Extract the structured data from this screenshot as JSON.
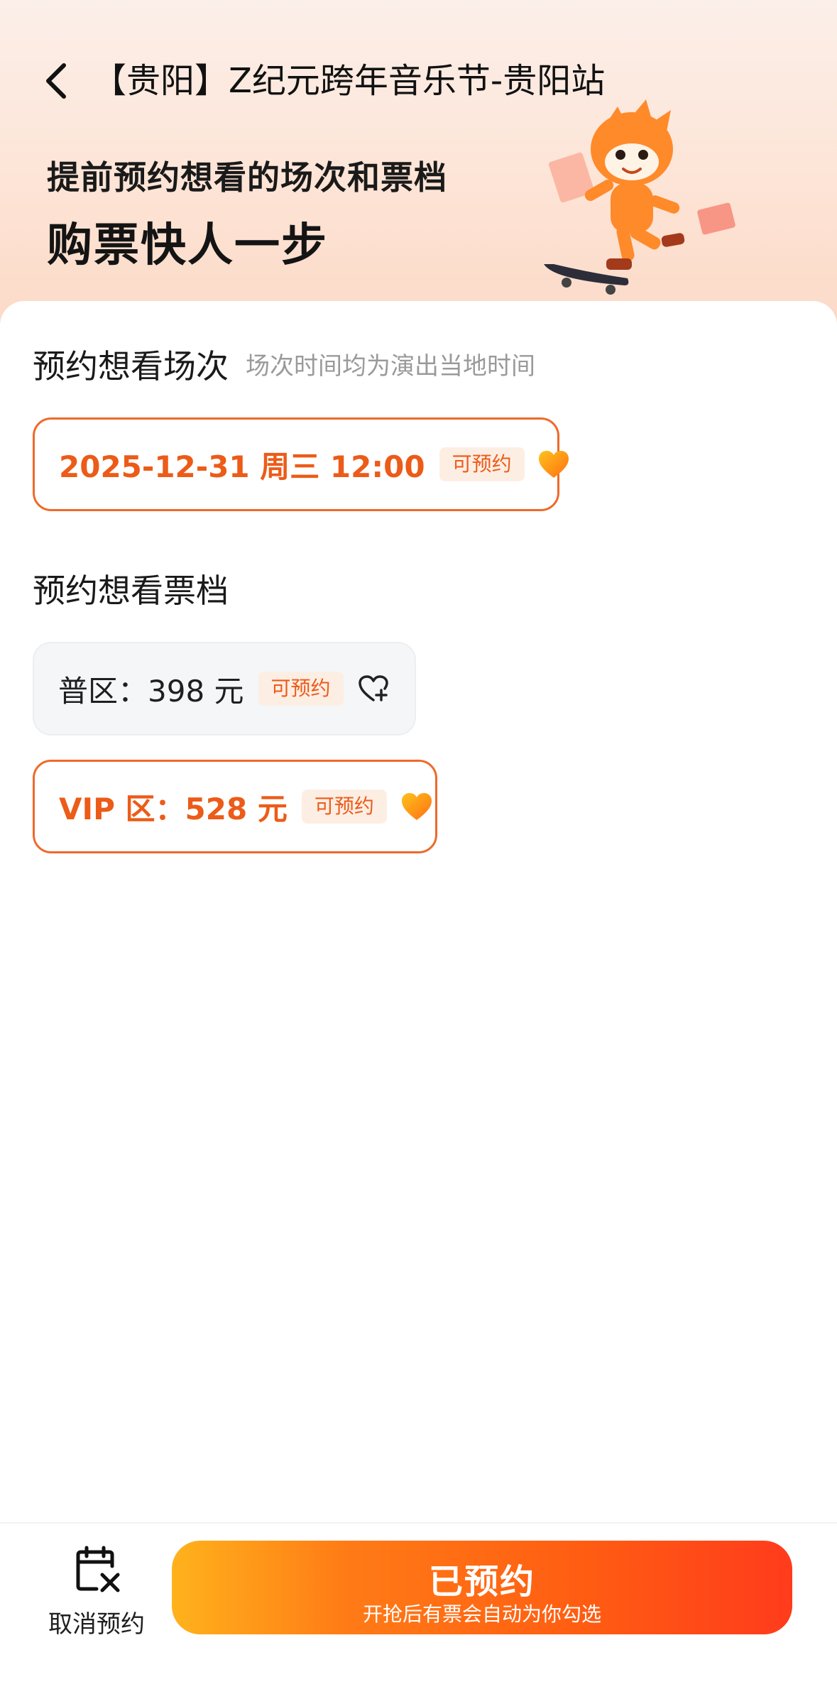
{
  "nav": {
    "title": "【贵阳】Z纪元跨年音乐节-贵阳站"
  },
  "banner": {
    "line1": "提前预约想看的场次和票档",
    "line2": "购票快人一步"
  },
  "session_section": {
    "title": "预约想看场次",
    "subtitle": "场次时间均为演出当地时间",
    "options": [
      {
        "label": "2025-12-31 周三 12:00",
        "badge": "可预约",
        "selected": true
      }
    ]
  },
  "ticket_section": {
    "title": "预约想看票档",
    "options": [
      {
        "label": "普区：398 元",
        "badge": "可预约",
        "selected": false
      },
      {
        "label": "VIP 区：528 元",
        "badge": "可预约",
        "selected": true
      }
    ]
  },
  "bottom": {
    "cancel_label": "取消预约",
    "reserve_main": "已预约",
    "reserve_sub": "开抢后有票会自动为你勾选"
  },
  "colors": {
    "accent": "#ec5b18",
    "badge_bg": "#fdeee4",
    "heart_gradient": [
      "#ffc21c",
      "#ff6f12"
    ]
  },
  "icons": {
    "back": "chevron-left-icon",
    "heart_filled": "heart-filled-icon",
    "heart_add": "heart-plus-icon",
    "cancel": "calendar-x-icon"
  }
}
